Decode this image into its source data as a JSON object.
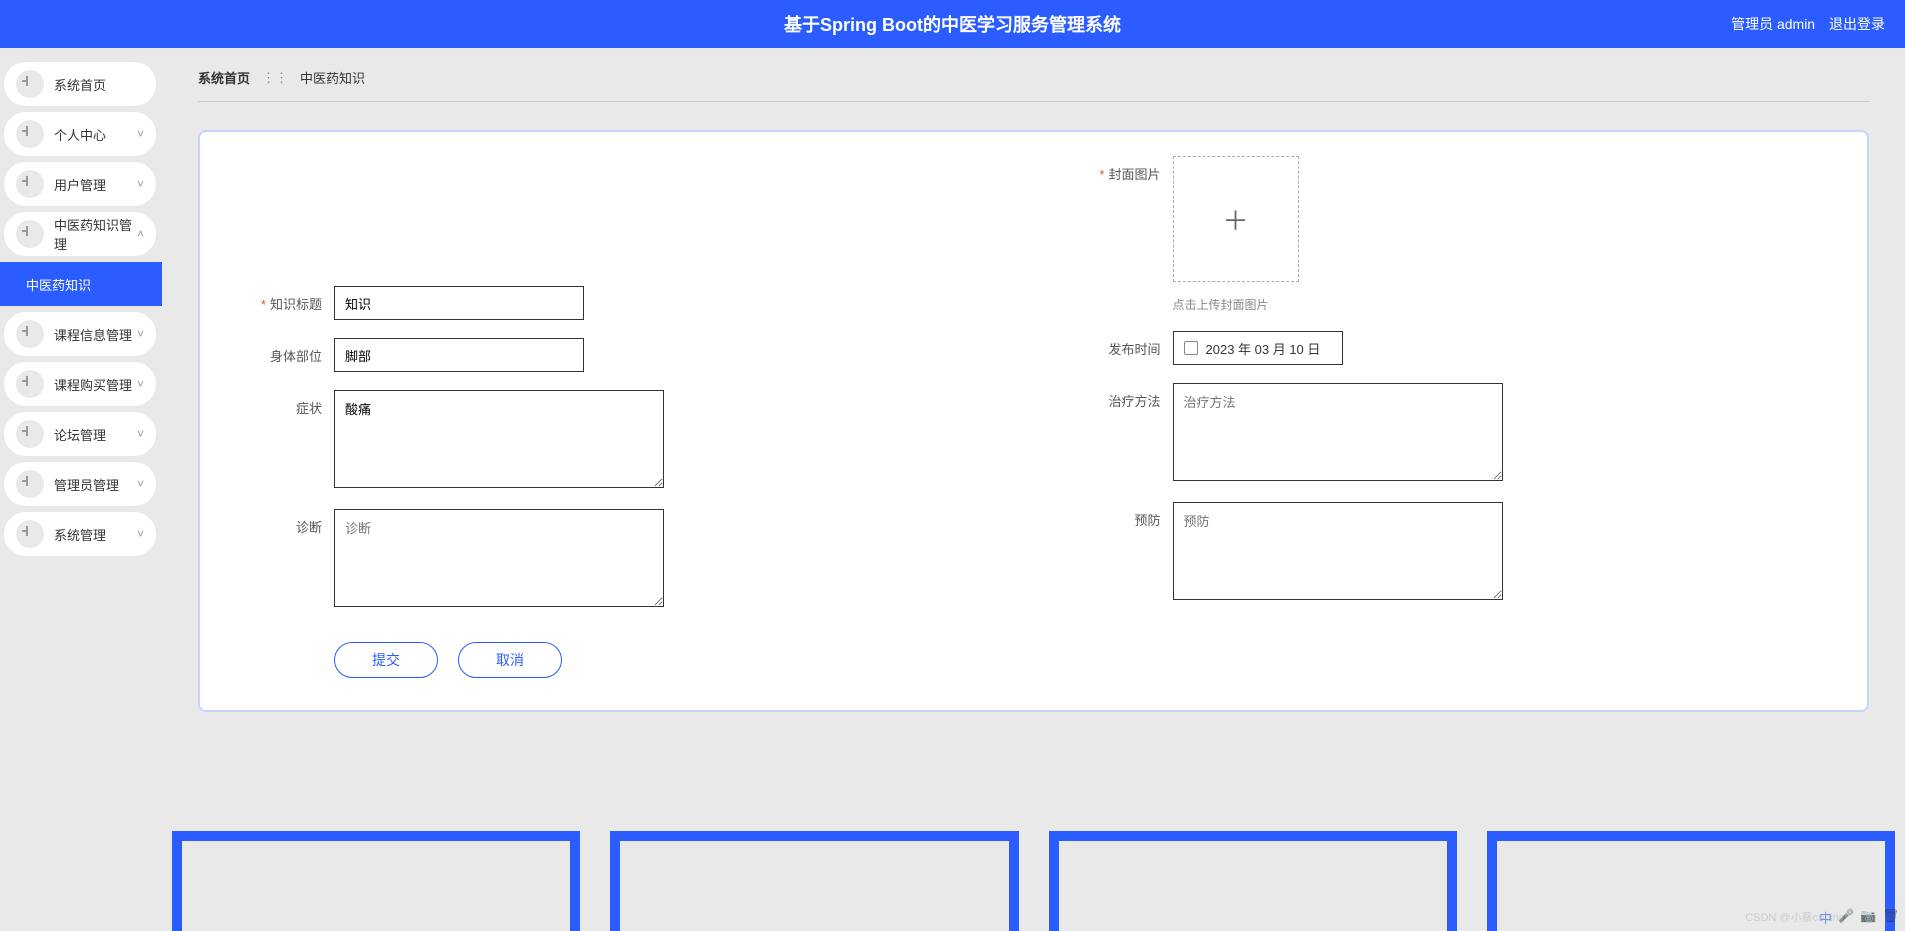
{
  "header": {
    "title": "基于Spring Boot的中医学习服务管理系统",
    "role": "管理员 admin",
    "logout": "退出登录"
  },
  "sidebar": {
    "items": [
      {
        "label": "系统首页",
        "arrow": ""
      },
      {
        "label": "个人中心",
        "arrow": "˅"
      },
      {
        "label": "用户管理",
        "arrow": "˅"
      },
      {
        "label": "中医药知识管理",
        "arrow": "˄",
        "expanded": true
      },
      {
        "label": "课程信息管理",
        "arrow": "˅"
      },
      {
        "label": "课程购买管理",
        "arrow": "˅"
      },
      {
        "label": "论坛管理",
        "arrow": "˅"
      },
      {
        "label": "管理员管理",
        "arrow": "˅"
      },
      {
        "label": "系统管理",
        "arrow": "˅"
      }
    ],
    "submenu": "中医药知识"
  },
  "breadcrumb": {
    "home": "系统首页",
    "current": "中医药知识"
  },
  "form": {
    "title_label": "知识标题",
    "title_value": "知识",
    "body_label": "身体部位",
    "body_value": "脚部",
    "symptom_label": "症状",
    "symptom_value": "酸痛",
    "diagnosis_label": "诊断",
    "diagnosis_placeholder": "诊断",
    "cover_label": "封面图片",
    "cover_hint": "点击上传封面图片",
    "date_label": "发布时间",
    "date_value": "2023 年 03 月 10 日",
    "treatment_label": "治疗方法",
    "treatment_placeholder": "治疗方法",
    "prevention_label": "预防",
    "prevention_placeholder": "预防",
    "submit": "提交",
    "cancel": "取消"
  },
  "watermark": "CSDN @小蔡coding"
}
